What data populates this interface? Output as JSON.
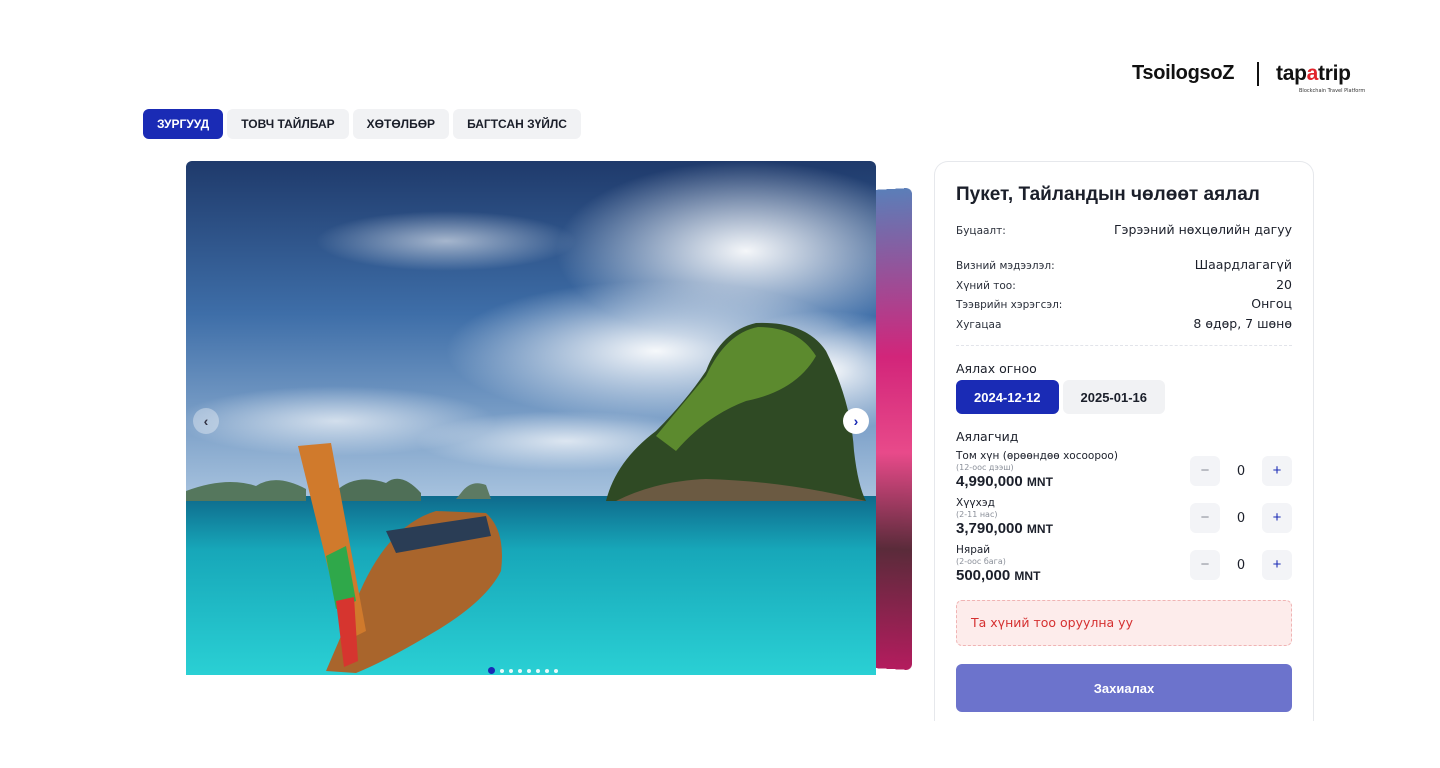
{
  "header": {
    "logo_left": "TsoilogsoZ",
    "logo_right_pre": "tap",
    "logo_right_accent": "a",
    "logo_right_post": "trip",
    "logo_right_tagline": "Blockchain Travel Platform"
  },
  "tabs": [
    {
      "label": "ЗУРГУУД",
      "active": true
    },
    {
      "label": "ТОВЧ ТАЙЛБАР",
      "active": false
    },
    {
      "label": "ХӨТӨЛБӨР",
      "active": false
    },
    {
      "label": "БАГТСАН ЗҮЙЛС",
      "active": false
    }
  ],
  "gallery": {
    "prev_icon": "chevron-left-icon",
    "next_icon": "chevron-right-icon",
    "prev_glyph": "‹",
    "next_glyph": "›",
    "dot_count": 8,
    "active_dot": 0
  },
  "booking": {
    "title": "Пукет, Тайландын чөлөөт аялал",
    "refund_label": "Буцаалт:",
    "refund_value": "Гэрээний нөхцөлийн дагуу",
    "details": [
      {
        "label": "Визний мэдээлэл:",
        "value": "Шаардлагагүй"
      },
      {
        "label": "Хүний тоо:",
        "value": "20"
      },
      {
        "label": "Тээврийн хэрэгсэл:",
        "value": "Онгоц"
      },
      {
        "label": "Хугацаа",
        "value": "8 өдөр, 7 шөнө"
      }
    ],
    "dates_label": "Аялах огноо",
    "dates": [
      {
        "label": "2024-12-12",
        "active": true
      },
      {
        "label": "2025-01-16",
        "active": false
      }
    ],
    "travelers_label": "Аялагчид",
    "travelers": [
      {
        "name": "Том хүн (өрөөндөө хосоороо)",
        "age": "(12-оос дээш)",
        "price": "4,990,000",
        "currency": "MNT",
        "count": "0"
      },
      {
        "name": "Хүүхэд",
        "age": "(2-11 нас)",
        "price": "3,790,000",
        "currency": "MNT",
        "count": "0"
      },
      {
        "name": "Нярай",
        "age": "(2-оос бага)",
        "price": "500,000",
        "currency": "MNT",
        "count": "0"
      }
    ],
    "minus_glyph": "−",
    "plus_glyph": "+",
    "alert": "Та хүний тоо оруулна уу",
    "submit_label": "Захиалах"
  },
  "colors": {
    "primary": "#1a2bb5",
    "submit": "#6c73cc",
    "alert_bg": "#fdeceb",
    "alert_text": "#d53030",
    "logo_accent": "#e0242b"
  }
}
